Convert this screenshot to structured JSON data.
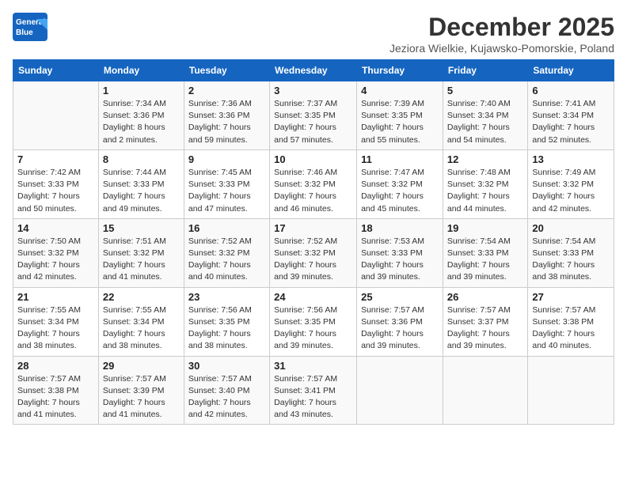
{
  "header": {
    "logo_line1": "General",
    "logo_line2": "Blue",
    "month": "December 2025",
    "location": "Jeziora Wielkie, Kujawsko-Pomorskie, Poland"
  },
  "weekdays": [
    "Sunday",
    "Monday",
    "Tuesday",
    "Wednesday",
    "Thursday",
    "Friday",
    "Saturday"
  ],
  "weeks": [
    [
      {
        "day": "",
        "info": ""
      },
      {
        "day": "1",
        "info": "Sunrise: 7:34 AM\nSunset: 3:36 PM\nDaylight: 8 hours\nand 2 minutes."
      },
      {
        "day": "2",
        "info": "Sunrise: 7:36 AM\nSunset: 3:36 PM\nDaylight: 7 hours\nand 59 minutes."
      },
      {
        "day": "3",
        "info": "Sunrise: 7:37 AM\nSunset: 3:35 PM\nDaylight: 7 hours\nand 57 minutes."
      },
      {
        "day": "4",
        "info": "Sunrise: 7:39 AM\nSunset: 3:35 PM\nDaylight: 7 hours\nand 55 minutes."
      },
      {
        "day": "5",
        "info": "Sunrise: 7:40 AM\nSunset: 3:34 PM\nDaylight: 7 hours\nand 54 minutes."
      },
      {
        "day": "6",
        "info": "Sunrise: 7:41 AM\nSunset: 3:34 PM\nDaylight: 7 hours\nand 52 minutes."
      }
    ],
    [
      {
        "day": "7",
        "info": "Sunrise: 7:42 AM\nSunset: 3:33 PM\nDaylight: 7 hours\nand 50 minutes."
      },
      {
        "day": "8",
        "info": "Sunrise: 7:44 AM\nSunset: 3:33 PM\nDaylight: 7 hours\nand 49 minutes."
      },
      {
        "day": "9",
        "info": "Sunrise: 7:45 AM\nSunset: 3:33 PM\nDaylight: 7 hours\nand 47 minutes."
      },
      {
        "day": "10",
        "info": "Sunrise: 7:46 AM\nSunset: 3:32 PM\nDaylight: 7 hours\nand 46 minutes."
      },
      {
        "day": "11",
        "info": "Sunrise: 7:47 AM\nSunset: 3:32 PM\nDaylight: 7 hours\nand 45 minutes."
      },
      {
        "day": "12",
        "info": "Sunrise: 7:48 AM\nSunset: 3:32 PM\nDaylight: 7 hours\nand 44 minutes."
      },
      {
        "day": "13",
        "info": "Sunrise: 7:49 AM\nSunset: 3:32 PM\nDaylight: 7 hours\nand 42 minutes."
      }
    ],
    [
      {
        "day": "14",
        "info": "Sunrise: 7:50 AM\nSunset: 3:32 PM\nDaylight: 7 hours\nand 42 minutes."
      },
      {
        "day": "15",
        "info": "Sunrise: 7:51 AM\nSunset: 3:32 PM\nDaylight: 7 hours\nand 41 minutes."
      },
      {
        "day": "16",
        "info": "Sunrise: 7:52 AM\nSunset: 3:32 PM\nDaylight: 7 hours\nand 40 minutes."
      },
      {
        "day": "17",
        "info": "Sunrise: 7:52 AM\nSunset: 3:32 PM\nDaylight: 7 hours\nand 39 minutes."
      },
      {
        "day": "18",
        "info": "Sunrise: 7:53 AM\nSunset: 3:33 PM\nDaylight: 7 hours\nand 39 minutes."
      },
      {
        "day": "19",
        "info": "Sunrise: 7:54 AM\nSunset: 3:33 PM\nDaylight: 7 hours\nand 39 minutes."
      },
      {
        "day": "20",
        "info": "Sunrise: 7:54 AM\nSunset: 3:33 PM\nDaylight: 7 hours\nand 38 minutes."
      }
    ],
    [
      {
        "day": "21",
        "info": "Sunrise: 7:55 AM\nSunset: 3:34 PM\nDaylight: 7 hours\nand 38 minutes."
      },
      {
        "day": "22",
        "info": "Sunrise: 7:55 AM\nSunset: 3:34 PM\nDaylight: 7 hours\nand 38 minutes."
      },
      {
        "day": "23",
        "info": "Sunrise: 7:56 AM\nSunset: 3:35 PM\nDaylight: 7 hours\nand 38 minutes."
      },
      {
        "day": "24",
        "info": "Sunrise: 7:56 AM\nSunset: 3:35 PM\nDaylight: 7 hours\nand 39 minutes."
      },
      {
        "day": "25",
        "info": "Sunrise: 7:57 AM\nSunset: 3:36 PM\nDaylight: 7 hours\nand 39 minutes."
      },
      {
        "day": "26",
        "info": "Sunrise: 7:57 AM\nSunset: 3:37 PM\nDaylight: 7 hours\nand 39 minutes."
      },
      {
        "day": "27",
        "info": "Sunrise: 7:57 AM\nSunset: 3:38 PM\nDaylight: 7 hours\nand 40 minutes."
      }
    ],
    [
      {
        "day": "28",
        "info": "Sunrise: 7:57 AM\nSunset: 3:38 PM\nDaylight: 7 hours\nand 41 minutes."
      },
      {
        "day": "29",
        "info": "Sunrise: 7:57 AM\nSunset: 3:39 PM\nDaylight: 7 hours\nand 41 minutes."
      },
      {
        "day": "30",
        "info": "Sunrise: 7:57 AM\nSunset: 3:40 PM\nDaylight: 7 hours\nand 42 minutes."
      },
      {
        "day": "31",
        "info": "Sunrise: 7:57 AM\nSunset: 3:41 PM\nDaylight: 7 hours\nand 43 minutes."
      },
      {
        "day": "",
        "info": ""
      },
      {
        "day": "",
        "info": ""
      },
      {
        "day": "",
        "info": ""
      }
    ]
  ]
}
